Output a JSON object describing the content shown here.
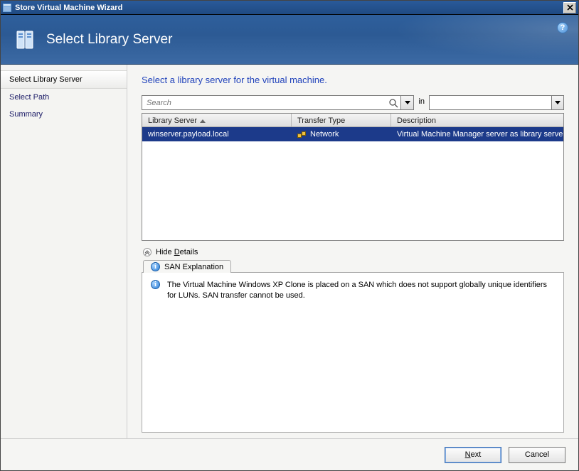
{
  "window": {
    "title": "Store Virtual Machine Wizard"
  },
  "banner": {
    "title": "Select Library Server"
  },
  "sidebar": {
    "items": [
      {
        "label": "Select Library Server",
        "active": true
      },
      {
        "label": "Select Path",
        "active": false
      },
      {
        "label": "Summary",
        "active": false
      }
    ]
  },
  "main": {
    "instruction": "Select a library server for the virtual machine.",
    "search": {
      "placeholder": "Search",
      "in_label": "in",
      "scope": ""
    },
    "grid": {
      "columns": [
        {
          "label": "Library Server",
          "sorted": "asc"
        },
        {
          "label": "Transfer Type"
        },
        {
          "label": "Description"
        }
      ],
      "rows": [
        {
          "server": "winserver.payload.local",
          "transfer": "Network",
          "description": "Virtual Machine Manager server as library server",
          "selected": true
        }
      ]
    },
    "details": {
      "toggle_label_pre": "Hide ",
      "toggle_label_u": "D",
      "toggle_label_post": "etails",
      "tab_label": "SAN Explanation",
      "message": "The Virtual Machine Windows XP Clone is placed on a SAN which does not support globally unique identifiers for LUNs. SAN transfer cannot be used."
    }
  },
  "footer": {
    "next_pre": "",
    "next_u": "N",
    "next_post": "ext",
    "cancel": "Cancel"
  }
}
